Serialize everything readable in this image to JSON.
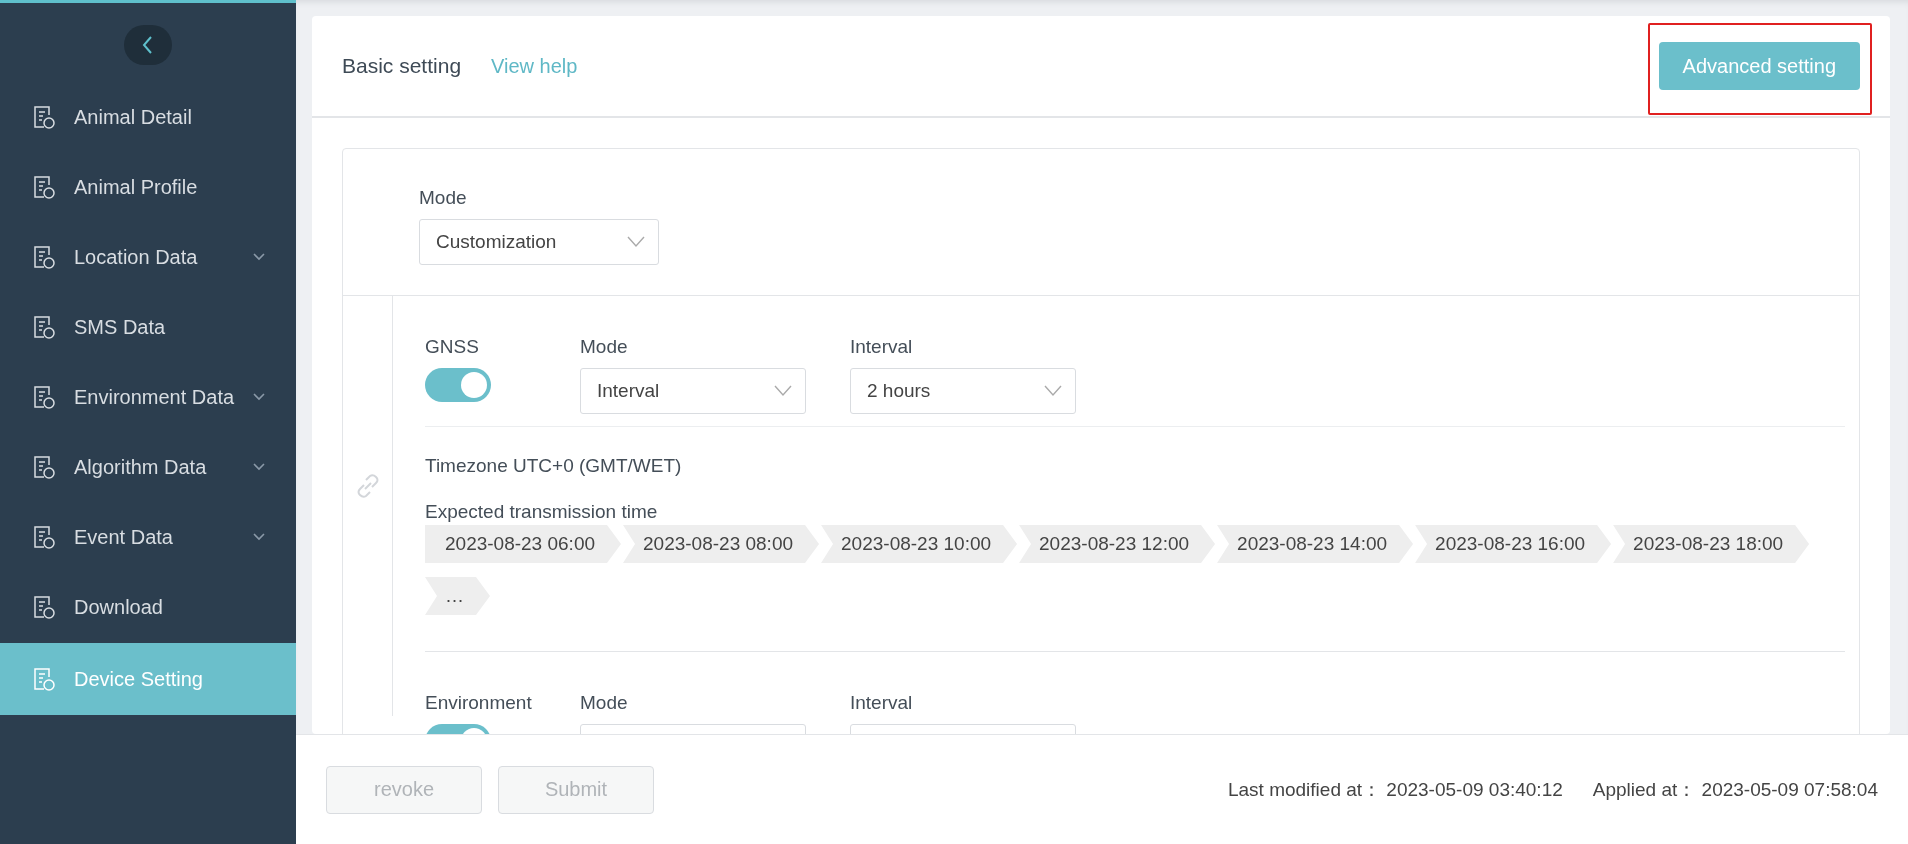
{
  "sidebar": {
    "items": [
      {
        "label": "Animal Detail",
        "submenu": false,
        "selected": false
      },
      {
        "label": "Animal Profile",
        "submenu": false,
        "selected": false
      },
      {
        "label": "Location Data",
        "submenu": true,
        "selected": false
      },
      {
        "label": "SMS Data",
        "submenu": false,
        "selected": false
      },
      {
        "label": "Environment Data",
        "submenu": true,
        "selected": false
      },
      {
        "label": "Algorithm Data",
        "submenu": true,
        "selected": false
      },
      {
        "label": "Event Data",
        "submenu": true,
        "selected": false
      },
      {
        "label": "Download",
        "submenu": false,
        "selected": false
      },
      {
        "label": "Device Setting",
        "submenu": false,
        "selected": true
      }
    ]
  },
  "header": {
    "title": "Basic setting",
    "help_link": "View help",
    "advanced_button": "Advanced setting",
    "highlighted": true
  },
  "mode": {
    "label": "Mode",
    "value": "Customization"
  },
  "sections": [
    {
      "name": "GNSS",
      "on": true,
      "mode_label": "Mode",
      "mode_value": "Interval",
      "interval_label": "Interval",
      "interval_value": "2 hours",
      "timezone": "Timezone UTC+0 (GMT/WET)",
      "expected_label": "Expected transmission time",
      "times": [
        "2023-08-23 06:00",
        "2023-08-23 08:00",
        "2023-08-23 10:00",
        "2023-08-23 12:00",
        "2023-08-23 14:00",
        "2023-08-23 16:00",
        "2023-08-23 18:00",
        "…"
      ]
    },
    {
      "name": "Environment",
      "on": true,
      "mode_label": "Mode",
      "interval_label": "Interval"
    }
  ],
  "footer": {
    "buttons": [
      {
        "label": "revoke",
        "disabled": true
      },
      {
        "label": "Submit",
        "disabled": true
      }
    ],
    "last_modified_label": "Last modified at：",
    "last_modified": "2023-05-09 03:40:12",
    "applied_label": "Applied at：",
    "applied": "2023-05-09 07:58:04"
  }
}
